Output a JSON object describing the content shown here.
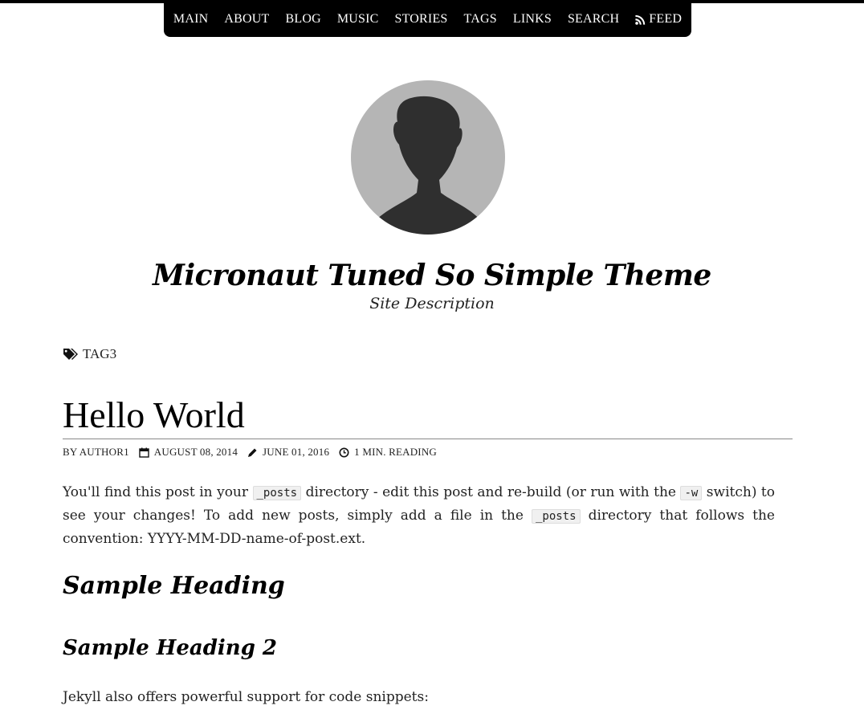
{
  "nav": {
    "items": [
      {
        "label": "MAIN"
      },
      {
        "label": "ABOUT"
      },
      {
        "label": "BLOG"
      },
      {
        "label": "MUSIC"
      },
      {
        "label": "STORIES"
      },
      {
        "label": "TAGS"
      },
      {
        "label": "LINKS"
      },
      {
        "label": "SEARCH"
      },
      {
        "label": "FEED",
        "icon": "rss-icon"
      }
    ]
  },
  "site": {
    "title": "Micronaut Tuned So Simple Theme",
    "description": "Site Description"
  },
  "tag": {
    "icon": "tags-icon",
    "label": "TAG3"
  },
  "post": {
    "title": "Hello World",
    "meta": {
      "author": "BY AUTHOR1",
      "published": "AUGUST 08, 2014",
      "updated": "JUNE 01, 2016",
      "reading": "1 MIN. READING"
    },
    "para1_a": "You'll find this post in your ",
    "code_posts": "_posts",
    "para1_b": " directory - edit this post and re-build (or run with the ",
    "code_w": "-w",
    "para1_c": " switch) to see your changes! To add new posts, simply add a file in the ",
    "para1_d": " directory that follows the convention: YYYY-MM-DD-name-of-post.ext.",
    "heading1": "Sample Heading",
    "heading2": "Sample Heading 2",
    "para2": "Jekyll also offers powerful support for code snippets:"
  },
  "colors": {
    "nav_bg": "#000000",
    "nav_text": "#ffffff",
    "avatar_bg": "#b5b5b5",
    "silhouette": "#2f2f2f"
  }
}
